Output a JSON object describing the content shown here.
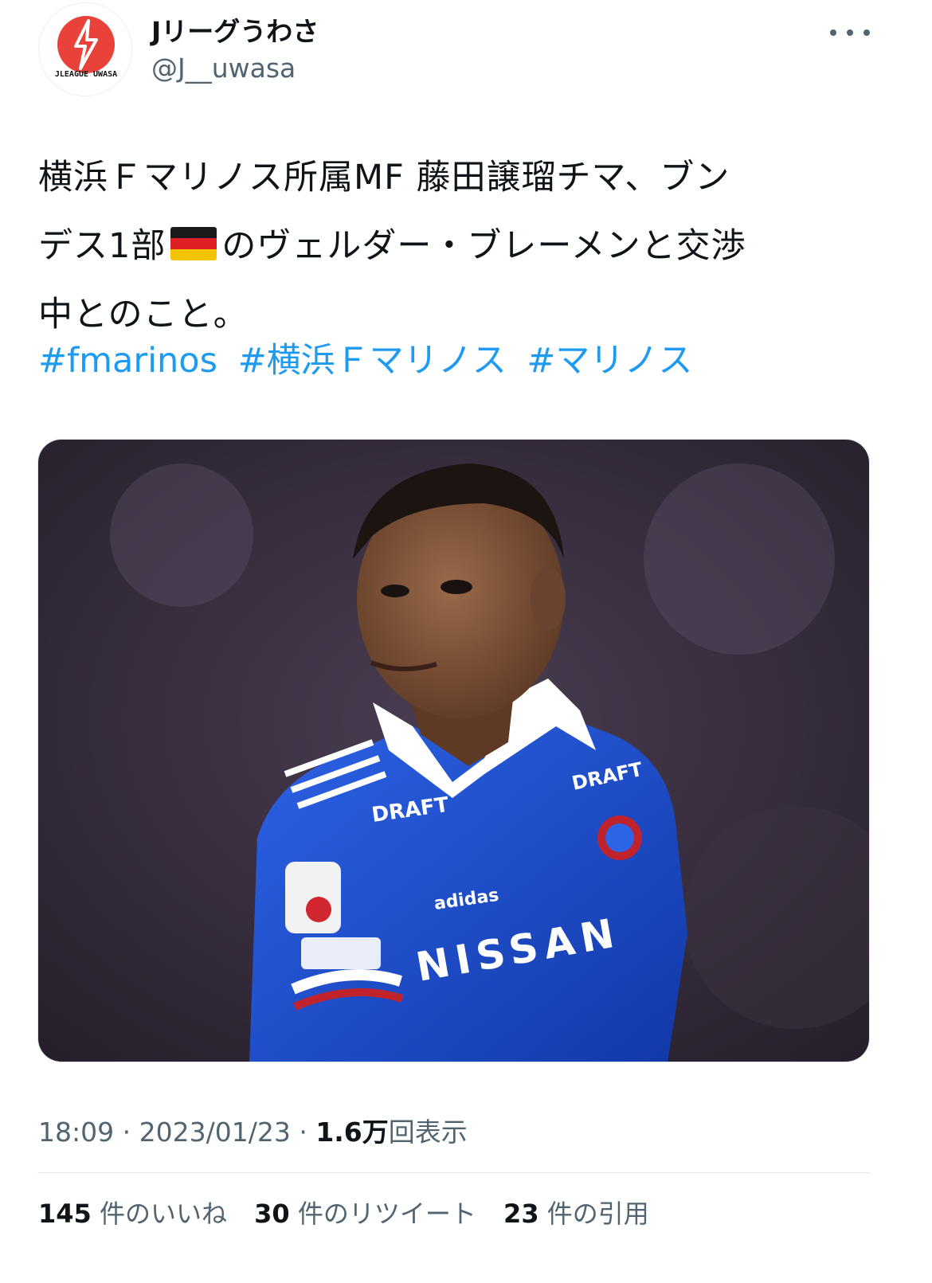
{
  "author": {
    "display_name": "Jリーグうわさ",
    "handle": "@J__uwasa",
    "avatar_text": "JLEAGUE UWASA",
    "avatar_color": "#e8423a"
  },
  "more_icon": "more-horizontal-icon",
  "tweet": {
    "lines": [
      "横浜Ｆマリノス所属MF 藤田譲瑠チマ、ブン",
      "デス1部",
      "のヴェルダー・ブレーメンと交渉",
      "中とのこと。"
    ],
    "flag_emoji": "germany-flag",
    "hashtags": [
      "#fmarinos",
      "#横浜Ｆマリノス",
      "#マリノス"
    ]
  },
  "media": {
    "description_icon": "player-photo",
    "jersey_texts": [
      "DRAFT",
      "DRAFT",
      "adidas",
      "NISSAN"
    ]
  },
  "meta": {
    "time": "18:09",
    "date": "2023/01/23",
    "views_count": "1.6万",
    "views_label": "回表示",
    "separator": "·"
  },
  "stats": [
    {
      "count": "145",
      "label": "件のいいね"
    },
    {
      "count": "30",
      "label": "件のリツイート"
    },
    {
      "count": "23",
      "label": "件の引用"
    }
  ],
  "colors": {
    "link": "#1d9bf0",
    "secondary_text": "#536471",
    "jersey_blue": "#1e4fd6"
  }
}
